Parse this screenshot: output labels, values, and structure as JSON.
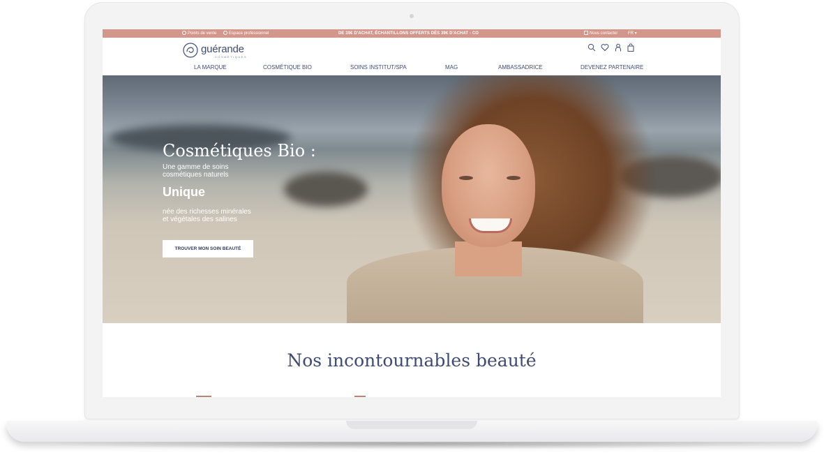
{
  "topbar": {
    "stores": "Points de vente",
    "pro": "Espace professionnel",
    "promo": "DE 39€ D'ACHAT, ÉCHANTILLONS OFFERTS DÈS 39€ D'ACHAT - CO",
    "contact": "Nous contacter",
    "lang": "FR"
  },
  "logo": {
    "word": "guérande",
    "sub": "COSMÉTIQUES"
  },
  "header_icons": [
    "search-icon",
    "heart-icon",
    "user-icon",
    "bag-icon"
  ],
  "nav": [
    "LA MARQUE",
    "COSMÉTIQUE BIO",
    "SOINS INSTITUT/SPA",
    "MAG",
    "AMBASSADRICE",
    "DEVENEZ PARTENAIRE"
  ],
  "hero": {
    "title": "Cosmétiques Bio :",
    "sub1_line1": "Une gamme de soins",
    "sub1_line2": "cosmétiques naturels",
    "highlight": "Unique",
    "sub2_line1": "née des richesses minérales",
    "sub2_line2": "et végétales des salines",
    "cta": "TROUVER MON SOIN BEAUTÉ"
  },
  "section": {
    "title": "Nos incontournables beauté"
  },
  "colors": {
    "topbar": "#d3968a",
    "navy": "#3f4b73"
  }
}
